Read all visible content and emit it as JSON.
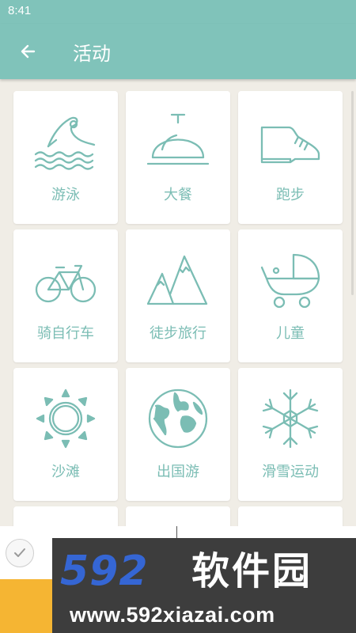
{
  "status_bar": {
    "time": "8:41"
  },
  "app_bar": {
    "title": "活动"
  },
  "activities": [
    {
      "label": "游泳",
      "icon": "swimming-icon"
    },
    {
      "label": "大餐",
      "icon": "dinner-cloche-icon"
    },
    {
      "label": "跑步",
      "icon": "running-shoe-icon"
    },
    {
      "label": "骑自行车",
      "icon": "bicycle-icon"
    },
    {
      "label": "徒步旅行",
      "icon": "mountains-icon"
    },
    {
      "label": "儿童",
      "icon": "baby-stroller-icon"
    },
    {
      "label": "沙滩",
      "icon": "sun-icon"
    },
    {
      "label": "出国游",
      "icon": "globe-icon"
    },
    {
      "label": "滑雪运动",
      "icon": "snowflake-icon"
    }
  ],
  "banner": {
    "numbers": "592",
    "brand": "软件园",
    "url": "www.592xiazai.com"
  },
  "colors": {
    "primary": "#80c3ba",
    "icon": "#7bbdb4",
    "background": "#f0ede6",
    "banner_blue": "#3566d4",
    "banner_bg": "#3d3d3d",
    "orange": "#f5b533"
  }
}
